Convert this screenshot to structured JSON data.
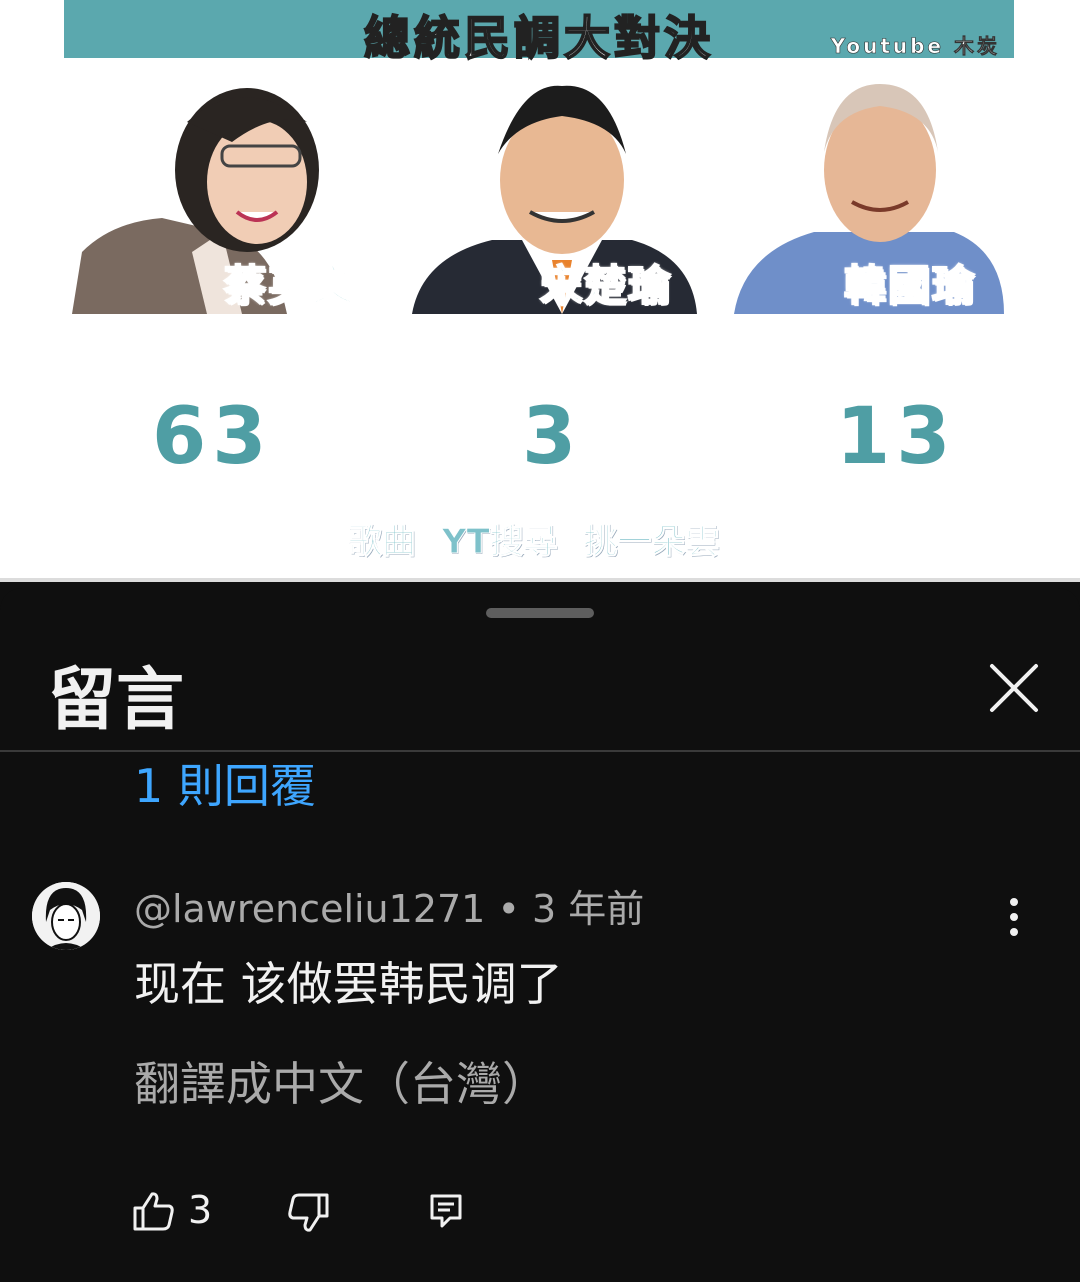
{
  "video": {
    "banner_title": "總統民調大對決",
    "banner_credit": "Youtube 木炭",
    "candidates": [
      {
        "name": "蔡英文",
        "score": "63"
      },
      {
        "name": "宋楚瑜",
        "score": "3"
      },
      {
        "name": "韓國瑜",
        "score": "13"
      }
    ],
    "song_caption": "歌曲 YT搜尋 挑一朵雲"
  },
  "sheet": {
    "title": "留言",
    "replies_link": "1 則回覆"
  },
  "comment": {
    "author": "@lawrenceliu1271",
    "separator": " • ",
    "time": "3 年前",
    "text": "现在 该做罢韩民调了",
    "translate_label": "翻譯成中文（台灣）",
    "like_count": "3"
  },
  "colors": {
    "banner": "#5ba8ae",
    "score": "#4f9ea4",
    "link": "#3ea6ff",
    "sheet_bg": "#0f0f0f"
  },
  "icons": [
    "close-icon",
    "more-vert-icon",
    "thumb-up-icon",
    "thumb-down-icon",
    "reply-icon"
  ]
}
